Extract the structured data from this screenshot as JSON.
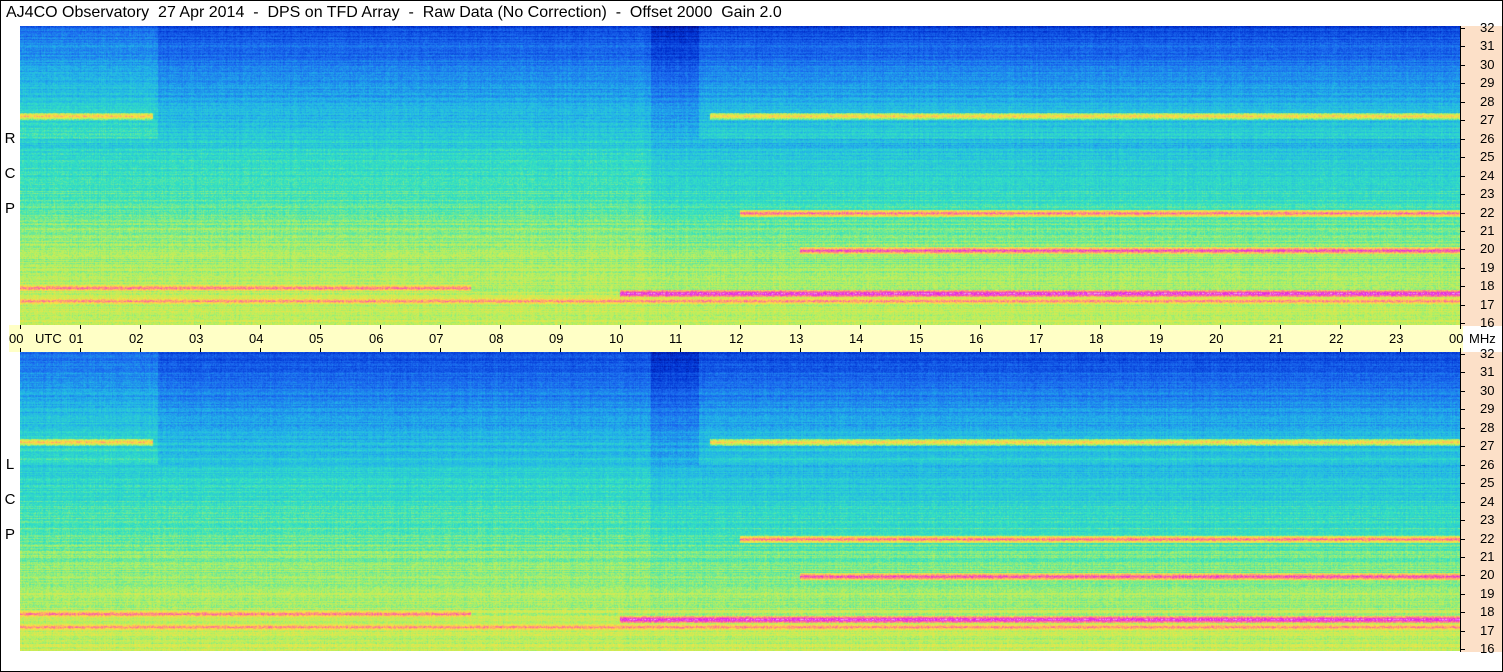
{
  "title": "AJ4CO Observatory  27 Apr 2014  -  DPS on TFD Array  -  Raw Data (No Correction)  -  Offset 2000  Gain 2.0",
  "panels": [
    {
      "id": "rcp",
      "label": [
        "R",
        "C",
        "P"
      ]
    },
    {
      "id": "lcp",
      "label": [
        "L",
        "C",
        "P"
      ]
    }
  ],
  "time_axis": {
    "unit_label": "UTC",
    "end_unit": "MHz",
    "ticks": [
      "00",
      "01",
      "02",
      "03",
      "04",
      "05",
      "06",
      "07",
      "08",
      "09",
      "10",
      "11",
      "12",
      "13",
      "14",
      "15",
      "16",
      "17",
      "18",
      "19",
      "20",
      "21",
      "22",
      "23",
      "00"
    ]
  },
  "freq_axis": {
    "ticks": [
      "32",
      "31",
      "30",
      "29",
      "28",
      "27",
      "26",
      "25",
      "24",
      "23",
      "22",
      "21",
      "20",
      "19",
      "18",
      "17",
      "16"
    ]
  },
  "colors": {
    "timebar": "#ffffc6",
    "freq_axis_bg": "#fce0c8",
    "colormap": [
      "#00007a",
      "#0030d0",
      "#1c6cf0",
      "#22b4e8",
      "#34e2c0",
      "#b6f060",
      "#ffe040",
      "#ff7a90",
      "#e020e8",
      "#ffffff"
    ]
  },
  "chart_data": {
    "type": "heatmap",
    "title": "AJ4CO Observatory  27 Apr 2014  -  DPS on TFD Array  -  Raw Data (No Correction)  -  Offset 2000  Gain 2.0",
    "x": {
      "label": "UTC",
      "range": [
        0,
        24
      ],
      "ticks": [
        "00",
        "01",
        "02",
        "03",
        "04",
        "05",
        "06",
        "07",
        "08",
        "09",
        "10",
        "11",
        "12",
        "13",
        "14",
        "15",
        "16",
        "17",
        "18",
        "19",
        "20",
        "21",
        "22",
        "23",
        "00"
      ]
    },
    "y": {
      "label": "MHz",
      "range": [
        16,
        32
      ],
      "ticks": [
        "16",
        "17",
        "18",
        "19",
        "20",
        "21",
        "22",
        "23",
        "24",
        "25",
        "26",
        "27",
        "28",
        "29",
        "30",
        "31",
        "32"
      ]
    },
    "series": [
      {
        "name": "RCP",
        "description_bands": [
          {
            "mhz": 27.2,
            "hours": [
              0,
              2.2
            ],
            "level": 0.72
          },
          {
            "mhz": 27.2,
            "hours": [
              11.5,
              24
            ],
            "level": 0.7
          },
          {
            "mhz": 22.0,
            "hours": [
              12,
              24
            ],
            "level": 0.8
          },
          {
            "mhz": 20.0,
            "hours": [
              13,
              24
            ],
            "level": 0.85
          },
          {
            "mhz": 18.0,
            "hours": [
              0,
              7.5
            ],
            "level": 0.8
          },
          {
            "mhz": 17.7,
            "hours": [
              10,
              24
            ],
            "level": 0.92
          },
          {
            "mhz": 17.3,
            "hours": [
              0,
              24
            ],
            "level": 0.78
          }
        ]
      },
      {
        "name": "LCP",
        "description_bands": [
          {
            "mhz": 27.2,
            "hours": [
              0,
              2.2
            ],
            "level": 0.72
          },
          {
            "mhz": 27.2,
            "hours": [
              11.5,
              24
            ],
            "level": 0.7
          },
          {
            "mhz": 22.0,
            "hours": [
              12,
              24
            ],
            "level": 0.8
          },
          {
            "mhz": 20.0,
            "hours": [
              13,
              24
            ],
            "level": 0.85
          },
          {
            "mhz": 18.0,
            "hours": [
              0,
              7.5
            ],
            "level": 0.8
          },
          {
            "mhz": 17.7,
            "hours": [
              10,
              24
            ],
            "level": 0.92
          },
          {
            "mhz": 17.3,
            "hours": [
              0,
              24
            ],
            "level": 0.78
          }
        ]
      }
    ]
  }
}
